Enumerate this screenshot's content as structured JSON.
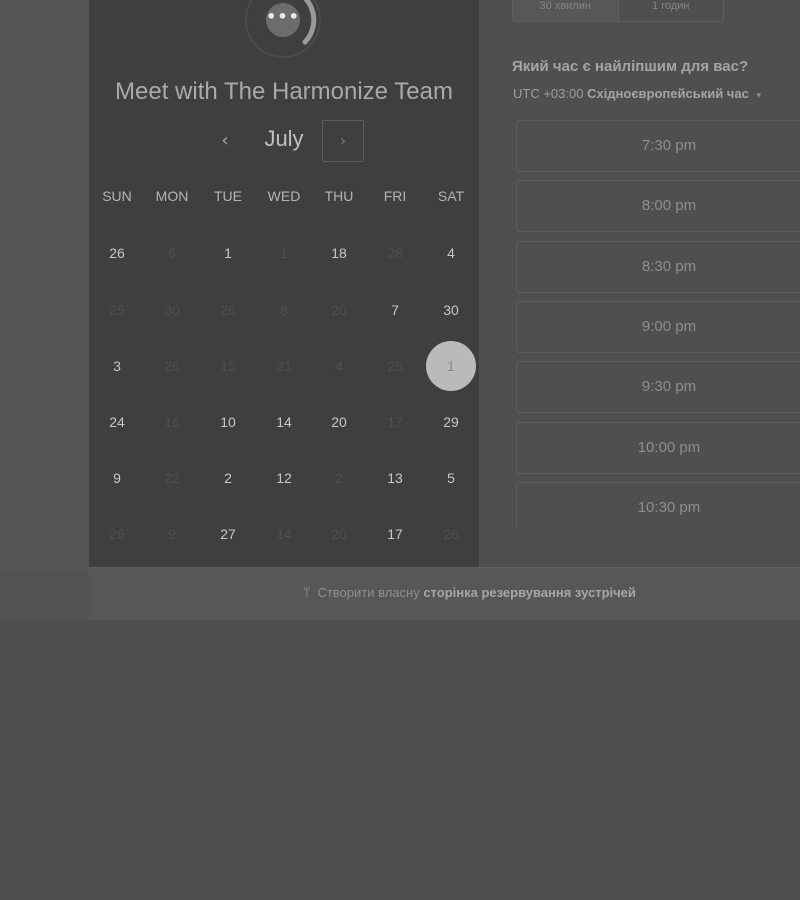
{
  "calendar": {
    "title": "Meet with The Harmonize Team",
    "avatar_icon": "more-dots-icon",
    "avatar_text": "•••",
    "month": "July",
    "prev_glyph": "‹",
    "next_glyph": "›",
    "weekdays": [
      "SUN",
      "MON",
      "TUE",
      "WED",
      "THU",
      "FRI",
      "SAT"
    ],
    "weeks": [
      [
        {
          "d": "26",
          "s": "active"
        },
        {
          "d": "6",
          "s": "muted"
        },
        {
          "d": "1",
          "s": "active"
        },
        {
          "d": "1",
          "s": "muted"
        },
        {
          "d": "18",
          "s": "active"
        },
        {
          "d": "28",
          "s": "muted"
        },
        {
          "d": "4",
          "s": "active"
        }
      ],
      [
        {
          "d": "25",
          "s": "muted"
        },
        {
          "d": "30",
          "s": "muted"
        },
        {
          "d": "26",
          "s": "muted"
        },
        {
          "d": "8",
          "s": "muted"
        },
        {
          "d": "20",
          "s": "muted"
        },
        {
          "d": "7",
          "s": "active"
        },
        {
          "d": "30",
          "s": "active"
        }
      ],
      [
        {
          "d": "3",
          "s": "active"
        },
        {
          "d": "26",
          "s": "muted"
        },
        {
          "d": "15",
          "s": "muted"
        },
        {
          "d": "31",
          "s": "muted"
        },
        {
          "d": "4",
          "s": "muted"
        },
        {
          "d": "25",
          "s": "muted"
        },
        {
          "d": "1",
          "s": "selected"
        }
      ],
      [
        {
          "d": "24",
          "s": "active"
        },
        {
          "d": "16",
          "s": "muted"
        },
        {
          "d": "10",
          "s": "active"
        },
        {
          "d": "14",
          "s": "active"
        },
        {
          "d": "20",
          "s": "active"
        },
        {
          "d": "17",
          "s": "muted"
        },
        {
          "d": "29",
          "s": "active"
        }
      ],
      [
        {
          "d": "9",
          "s": "active"
        },
        {
          "d": "22",
          "s": "muted"
        },
        {
          "d": "2",
          "s": "active"
        },
        {
          "d": "12",
          "s": "active"
        },
        {
          "d": "2",
          "s": "muted"
        },
        {
          "d": "13",
          "s": "active"
        },
        {
          "d": "5",
          "s": "active"
        }
      ],
      [
        {
          "d": "26",
          "s": "muted"
        },
        {
          "d": "9",
          "s": "muted"
        },
        {
          "d": "27",
          "s": "active"
        },
        {
          "d": "14",
          "s": "muted"
        },
        {
          "d": "20",
          "s": "muted"
        },
        {
          "d": "17",
          "s": "active"
        },
        {
          "d": "26",
          "s": "muted"
        }
      ]
    ]
  },
  "duration": {
    "options": [
      "30 хвилин",
      "1 годин"
    ],
    "selected": "30 хвилин"
  },
  "times": {
    "heading": "Який час є найліпшим для вас?",
    "tz_offset": "UTC +03:00",
    "tz_name": "Східноєвропейський час",
    "tz_caret": "▾",
    "slots": [
      "7:30 pm",
      "8:00 pm",
      "8:30 pm",
      "9:00 pm",
      "9:30 pm",
      "10:00 pm",
      "10:30 pm"
    ]
  },
  "footer": {
    "icon": "hubspot-sprocket-icon",
    "icon_glyph": "ᛘ",
    "prefix": "Створити власну",
    "link": "сторінка резервування зустрічей"
  }
}
